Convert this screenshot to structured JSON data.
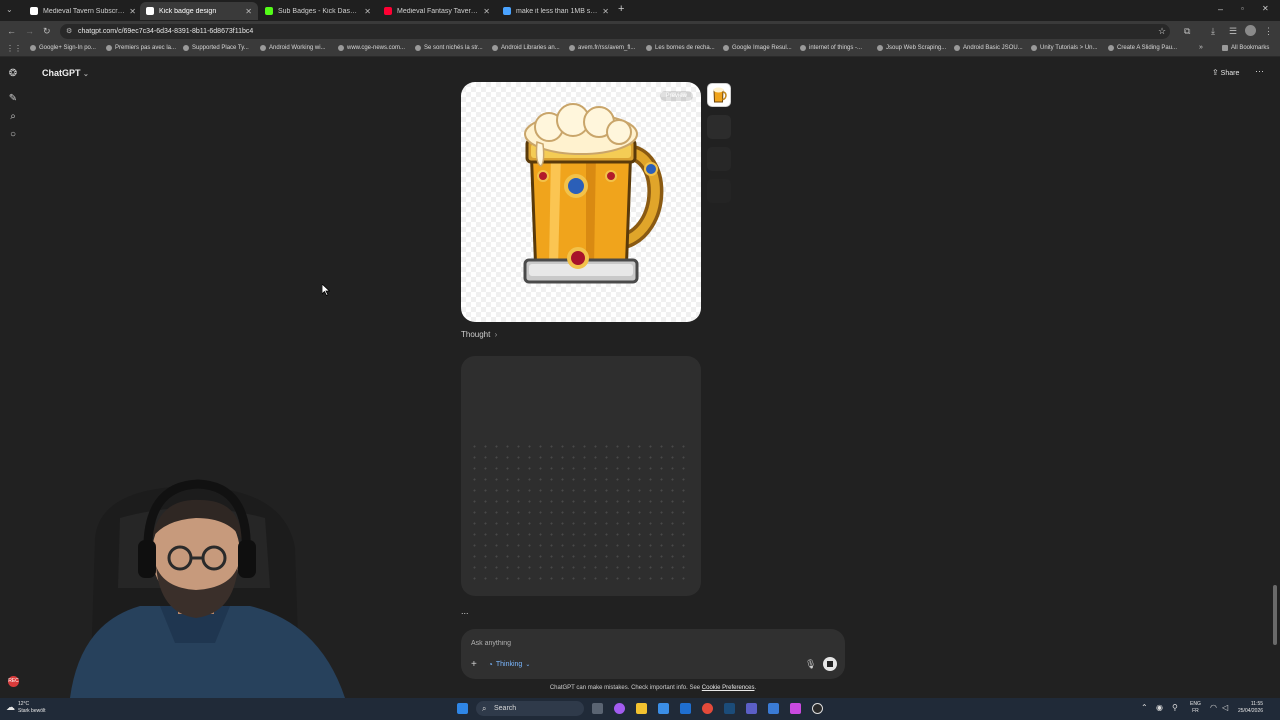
{
  "browser": {
    "tabs": [
      {
        "label": "Medieval Tavern Subscriber Ba",
        "favicon_color": "#ffffff",
        "active": false
      },
      {
        "label": "Kick badge design",
        "favicon_color": "#ffffff",
        "active": true
      },
      {
        "label": "Sub Badges - Kick Dashboard",
        "favicon_color": "#53fc18",
        "active": false
      },
      {
        "label": "Medieval Fantasy Tavern 3",
        "favicon_color": "#ff0033",
        "active": false
      },
      {
        "label": "make it less than 1MB size - Gr",
        "favicon_color": "#4aa3ff",
        "active": false
      }
    ],
    "new_tab": "+",
    "url": "chatgpt.com/c/69ec7c34-6d34-8391-8b11-6d8673f11bc4",
    "bookmarks": [
      "Google+ Sign-In po...",
      "Premiers pas avec la...",
      "Supported Place Ty...",
      "Android Working wi...",
      "www.cge-news.com...",
      "Se sont nichés la str...",
      "Android Libraries an...",
      "avem.fr/rss/avem_fl...",
      "Les bornes de recha...",
      "Google Image Resul...",
      "internet of things -...",
      "Jsoup Web Scraping...",
      "Android Basic JSOU...",
      "Unity Tutorials > Un...",
      "Create A Sliding Pau..."
    ],
    "all_bookmarks": "All Bookmarks"
  },
  "app": {
    "model": "ChatGPT",
    "share": "Share",
    "image_preview_tag": "Preview",
    "thought_label": "Thought",
    "thought_chevron": "›",
    "ellipsis": "...",
    "composer": {
      "placeholder": "Ask anything",
      "plus": "+",
      "thinking": "Thinking"
    },
    "disclaimer_text": "ChatGPT can make mistakes. Check important info. See ",
    "disclaimer_link": "Cookie Preferences",
    "disclaimer_end": "."
  },
  "taskbar": {
    "weather_temp": "12°C",
    "weather_desc": "Stark bewölt",
    "search": "Search",
    "lang_top": "ENG",
    "lang_bottom": "FR",
    "time": "11:55",
    "date": "25/04/2026"
  },
  "rec_badge": "REC"
}
